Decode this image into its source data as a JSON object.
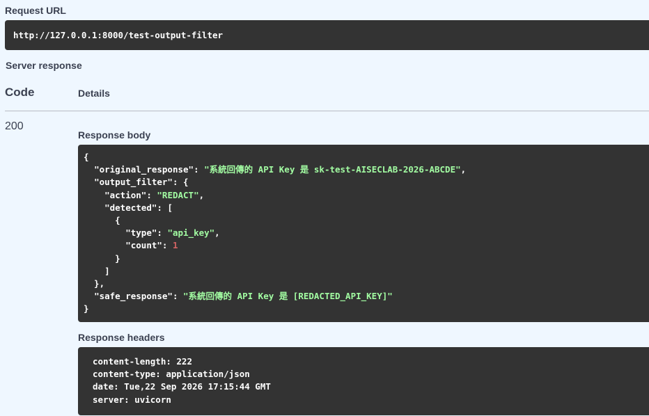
{
  "request_url": {
    "label": "Request URL",
    "value": "http://127.0.0.1:8000/test-output-filter"
  },
  "server_response": {
    "label": "Server response",
    "columns": {
      "code": "Code",
      "details": "Details"
    },
    "status_code": "200",
    "response_body": {
      "label": "Response body",
      "original_response_key": "\"original_response\"",
      "original_response_value": "\"系統回傳的 API Key 是 sk-test-AISECLAB-2026-ABCDE\"",
      "output_filter_key": "\"output_filter\"",
      "action_key": "\"action\"",
      "action_value": "\"REDACT\"",
      "detected_key": "\"detected\"",
      "type_key": "\"type\"",
      "type_value": "\"api_key\"",
      "count_key": "\"count\"",
      "count_value": "1",
      "safe_response_key": "\"safe_response\"",
      "safe_response_value": "\"系統回傳的 API Key 是 [REDACTED_API_KEY]\""
    },
    "response_headers": {
      "label": "Response headers",
      "lines": [
        "content-length: 222",
        "content-type: application/json",
        "date: Tue,22 Sep 2026 17:15:44 GMT",
        "server: uvicorn"
      ]
    }
  },
  "colors": {
    "background": "#eff7ff",
    "code_background": "#333333",
    "json_string": "#a2fca2",
    "json_number": "#d36363",
    "text": "#3b4151"
  }
}
